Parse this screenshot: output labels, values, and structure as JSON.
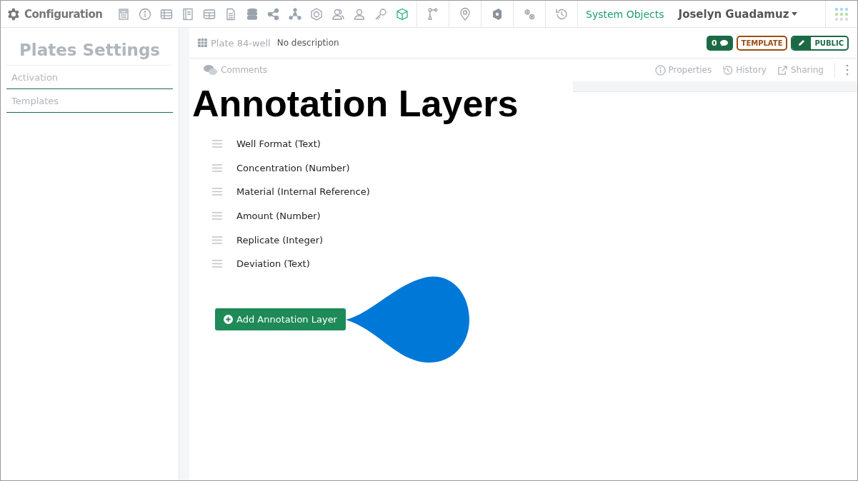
{
  "app": {
    "title": "Configuration"
  },
  "toolbar": [
    {
      "kind": "form",
      "selected": false
    },
    {
      "kind": "info",
      "selected": false
    },
    {
      "kind": "table",
      "selected": false
    },
    {
      "kind": "book",
      "selected": false
    },
    {
      "kind": "grid",
      "selected": false
    },
    {
      "kind": "document",
      "selected": false
    },
    {
      "kind": "database",
      "selected": false
    },
    {
      "kind": "share",
      "selected": false
    },
    {
      "kind": "network",
      "selected": false
    },
    {
      "kind": "badge",
      "selected": false
    },
    {
      "kind": "users",
      "selected": false
    },
    {
      "kind": "user",
      "selected": false
    },
    {
      "kind": "key",
      "selected": false
    },
    {
      "kind": "cube",
      "selected": true
    }
  ],
  "tools": [
    {
      "kind": "branch"
    },
    {
      "kind": "pin"
    },
    {
      "kind": "shield"
    },
    {
      "kind": "gears"
    },
    {
      "kind": "history"
    }
  ],
  "system_link": "System Objects",
  "user": {
    "name": "Joselyn Guadamuz"
  },
  "sidebar": {
    "title": "Plates Settings",
    "items": [
      {
        "label": "Activation",
        "selected": false
      },
      {
        "label": "Templates",
        "selected": false
      }
    ]
  },
  "record": {
    "name": "Plate 84-well",
    "description": "No description",
    "comment_count": "0",
    "template_badge": "TEMPLATE",
    "visibility": "PUBLIC"
  },
  "actions": {
    "left": "Comments",
    "right": [
      "Properties",
      "History",
      "Sharing"
    ]
  },
  "heading": "Annotation Layers",
  "layers": [
    "Well Format (Text)",
    "Concentration (Number)",
    "Material (Internal Reference)",
    "Amount (Number)",
    "Replicate (Integer)",
    "Deviation (Text)"
  ],
  "add_button": "Add Annotation Layer"
}
